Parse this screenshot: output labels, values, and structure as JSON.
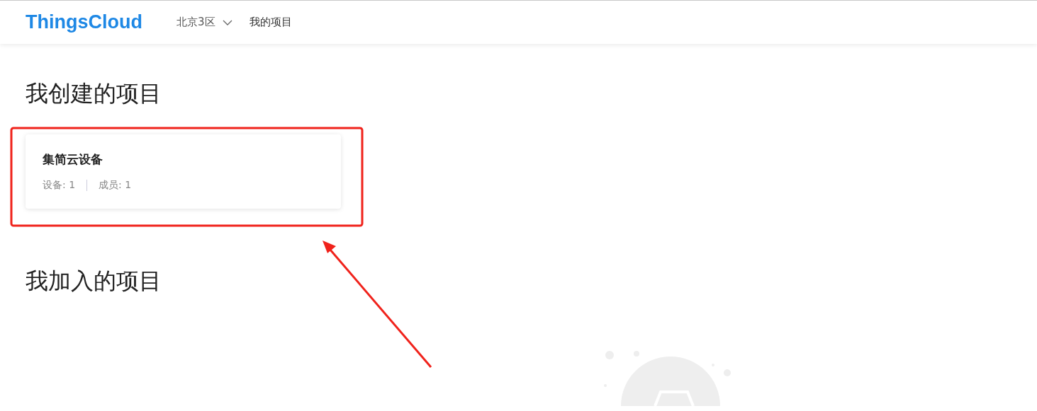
{
  "header": {
    "logo": "ThingsCloud",
    "region": "北京3区",
    "nav": "我的项目"
  },
  "sections": [
    {
      "title": "我创建的项目",
      "projects": [
        {
          "name": "集简云设备",
          "stats": [
            "设备: 1",
            "成员: 1"
          ]
        }
      ]
    },
    {
      "title": "我加入的项目",
      "empty": true
    }
  ]
}
